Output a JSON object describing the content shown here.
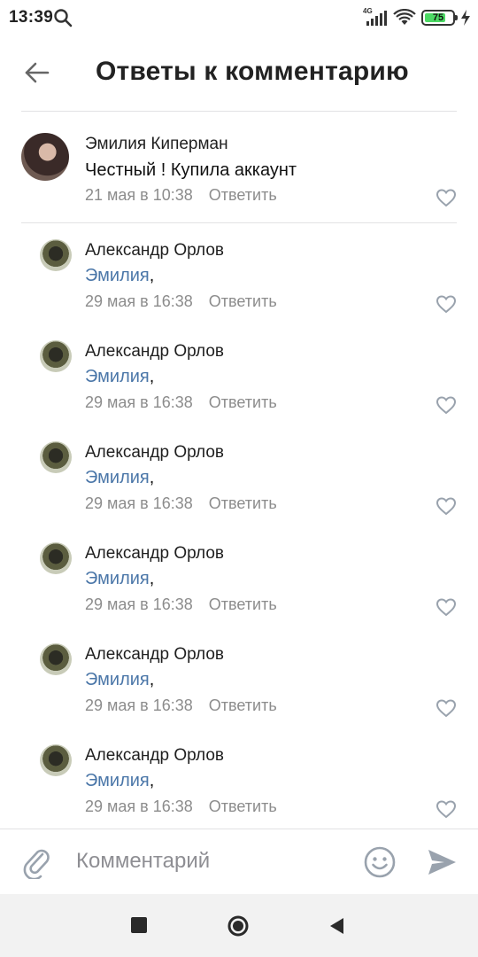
{
  "status_bar": {
    "time": "13:39",
    "network": "4G",
    "battery_percent": "75",
    "battery_level": 0.75,
    "icons": [
      "search-icon",
      "signal-icon",
      "wifi-icon",
      "battery-icon",
      "charging-icon"
    ]
  },
  "header": {
    "title": "Ответы к комментарию",
    "back_icon": "arrow-left-icon"
  },
  "root_comment": {
    "author": "Эмилия Киперман",
    "text": "Честный ! Купила аккаунт",
    "date": "21 мая в 10:38",
    "reply_label": "Ответить",
    "like_icon": "heart-icon"
  },
  "replies": [
    {
      "author": "Александр Орлов",
      "mention": "Эмилия",
      "suffix": ",",
      "date": "29 мая в 16:38",
      "reply_label": "Ответить"
    },
    {
      "author": "Александр Орлов",
      "mention": "Эмилия",
      "suffix": ",",
      "date": "29 мая в 16:38",
      "reply_label": "Ответить"
    },
    {
      "author": "Александр Орлов",
      "mention": "Эмилия",
      "suffix": ",",
      "date": "29 мая в 16:38",
      "reply_label": "Ответить"
    },
    {
      "author": "Александр Орлов",
      "mention": "Эмилия",
      "suffix": ",",
      "date": "29 мая в 16:38",
      "reply_label": "Ответить"
    },
    {
      "author": "Александр Орлов",
      "mention": "Эмилия",
      "suffix": ",",
      "date": "29 мая в 16:38",
      "reply_label": "Ответить"
    },
    {
      "author": "Александр Орлов",
      "mention": "Эмилия",
      "suffix": ",",
      "date": "29 мая в 16:38",
      "reply_label": "Ответить"
    }
  ],
  "composer": {
    "placeholder": "Комментарий",
    "value": "",
    "icons": [
      "paperclip-icon",
      "emoji-icon",
      "send-icon"
    ]
  },
  "colors": {
    "link": "#4a76a8",
    "secondary_text": "#8c8c8c",
    "divider": "#e2e2e4",
    "icon_gray": "#99a2ad"
  }
}
